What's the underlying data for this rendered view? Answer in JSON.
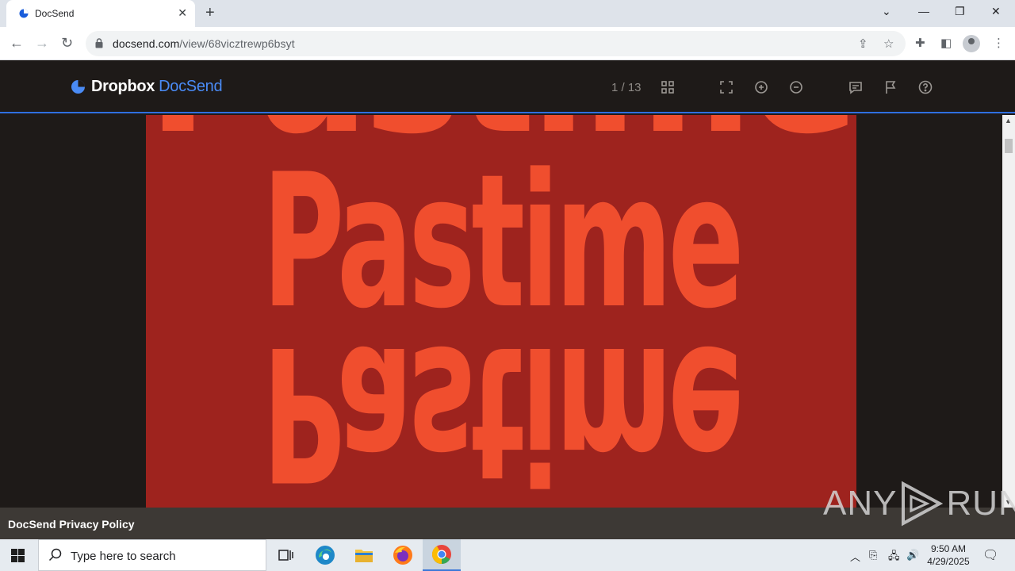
{
  "browser": {
    "tab_title": "DocSend",
    "new_tab_symbol": "+",
    "url_domain": "docsend.com",
    "url_path": "/view/68vicztrewp6bsyt"
  },
  "app": {
    "brand": "Dropbox",
    "product": "DocSend",
    "page_indicator": "1 / 13",
    "toolbar_icons": [
      "grid-icon",
      "fullscreen-icon",
      "zoom-in-icon",
      "zoom-out-icon",
      "comment-icon",
      "flag-icon",
      "help-icon"
    ],
    "accent_color": "#2f6fe0"
  },
  "slide": {
    "headline": "Pastime",
    "reflection": "Pastime",
    "top_fragment": "Pastime",
    "background_color": "#9e231e",
    "text_color": "#f04e2e"
  },
  "footer": {
    "privacy_link": "DocSend Privacy Policy"
  },
  "watermark": {
    "left": "ANY",
    "right": "RUN"
  },
  "taskbar": {
    "search_placeholder": "Type here to search",
    "time": "9:50 AM",
    "date": "4/29/2025"
  }
}
